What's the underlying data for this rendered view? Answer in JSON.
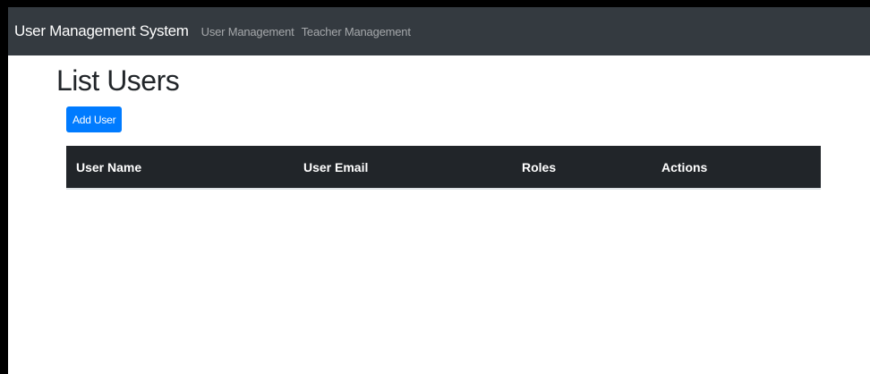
{
  "navbar": {
    "brand": "User Management System",
    "links": [
      {
        "label": "User Management"
      },
      {
        "label": "Teacher Management"
      }
    ]
  },
  "page": {
    "title": "List Users",
    "add_button_label": "Add User"
  },
  "table": {
    "headers": [
      "User Name",
      "User Email",
      "Roles",
      "Actions"
    ],
    "rows": []
  },
  "colors": {
    "navbar_bg": "#343a40",
    "primary": "#007bff",
    "table_header_bg": "#212529"
  }
}
